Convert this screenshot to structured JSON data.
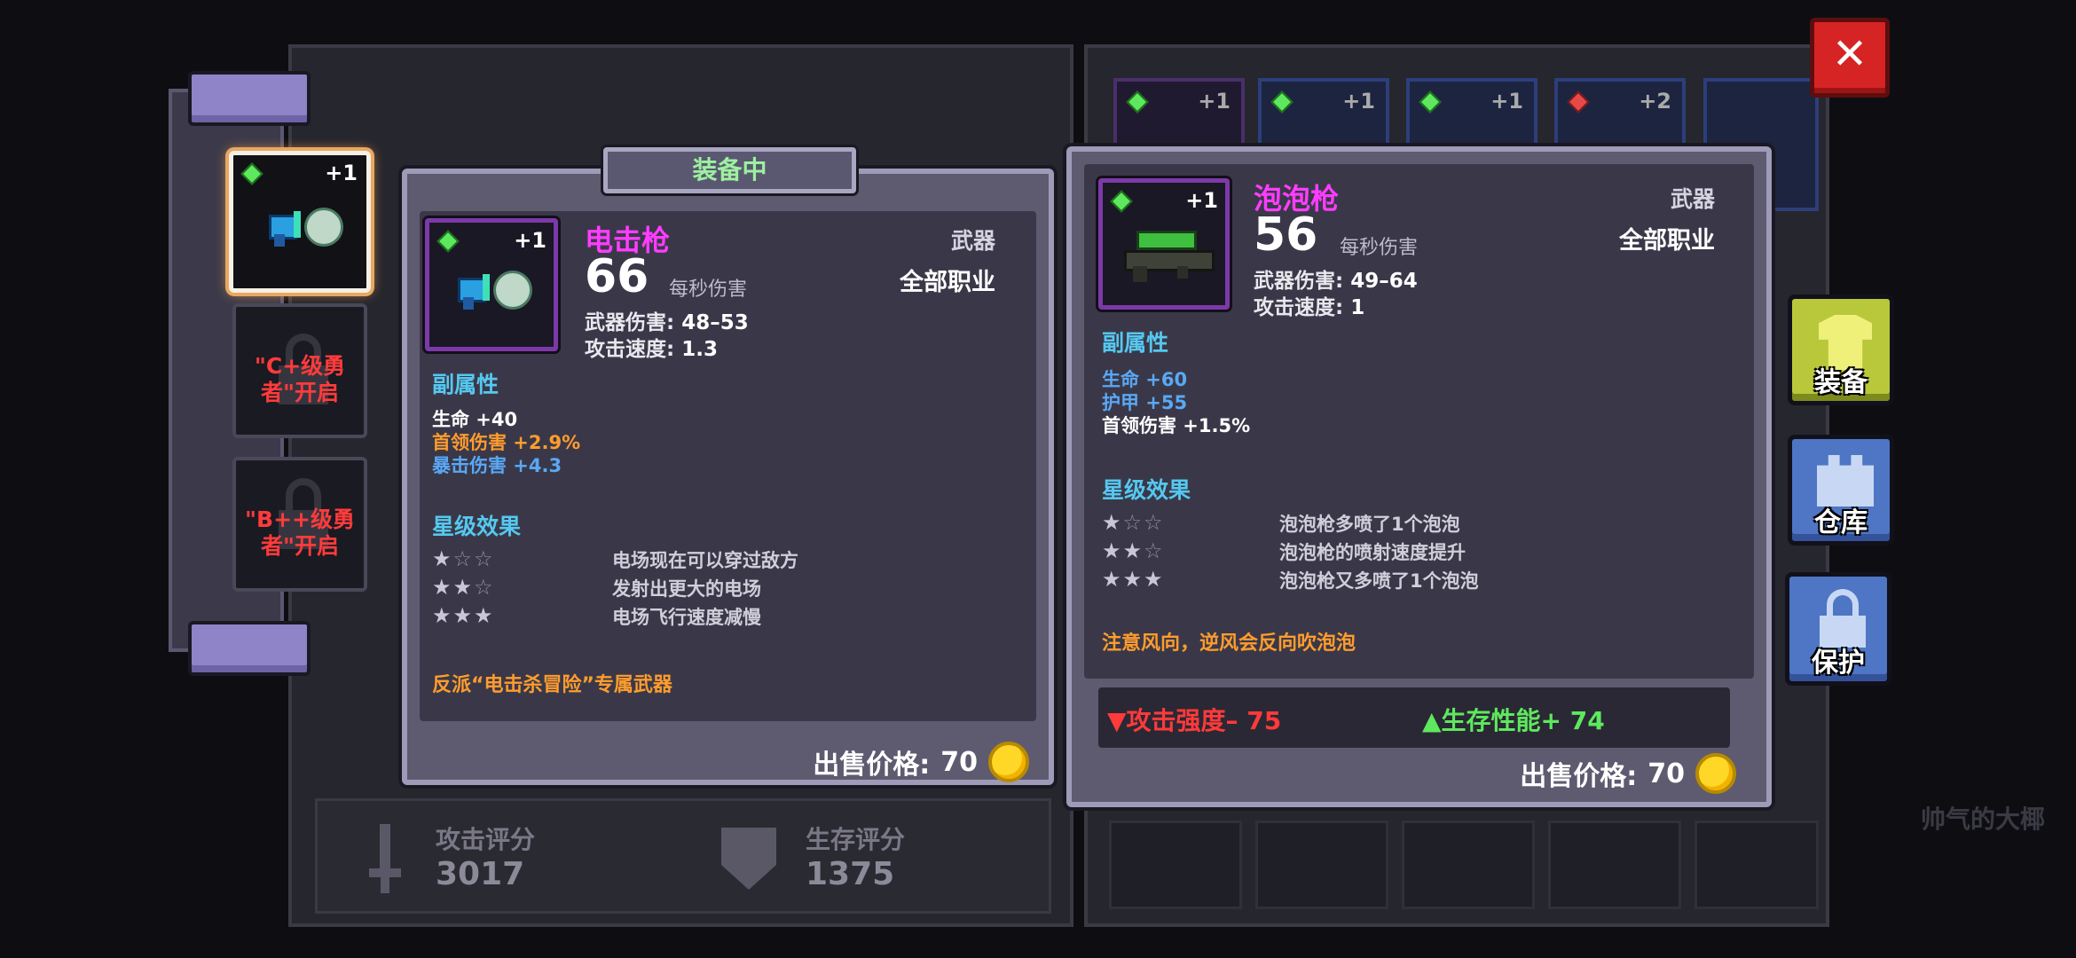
{
  "equipped_tab": "装备中",
  "slots": [
    {
      "level": "+1",
      "active": true
    },
    {
      "locked_text": "\"C+级勇者\"开启"
    },
    {
      "locked_text": "\"B++级勇者\"开启"
    }
  ],
  "equipped": {
    "level": "+1",
    "name": "电击枪",
    "dps": "66",
    "dps_label": "每秒伤害",
    "category": "武器",
    "class": "全部职业",
    "weapon_damage_label": "武器伤害:",
    "weapon_damage": "48–53",
    "attack_speed_label": "攻击速度:",
    "attack_speed": "1.3",
    "sub_title": "副属性",
    "affixes": [
      {
        "text": "生命 +40",
        "color": "#ffffff"
      },
      {
        "text": "首领伤害 +2.9%",
        "color": "#ff9c2e"
      },
      {
        "text": "暴击伤害 +4.3",
        "color": "#5aa8f5"
      }
    ],
    "star_title": "星级效果",
    "star_effects": [
      {
        "stars": 1,
        "text": "电场现在可以穿过敌方"
      },
      {
        "stars": 2,
        "text": "发射出更大的电场"
      },
      {
        "stars": 3,
        "text": "电场飞行速度减慢"
      }
    ],
    "note": "反派“电击杀冒险”专属武器",
    "price_label": "出售价格:",
    "price": "70"
  },
  "candidate": {
    "level": "+1",
    "name": "泡泡枪",
    "dps": "56",
    "dps_label": "每秒伤害",
    "category": "武器",
    "class": "全部职业",
    "weapon_damage_label": "武器伤害:",
    "weapon_damage": "49–64",
    "attack_speed_label": "攻击速度:",
    "attack_speed": "1",
    "sub_title": "副属性",
    "affixes": [
      {
        "text": "生命 +60",
        "color": "#5aa8f5"
      },
      {
        "text": "护甲 +55",
        "color": "#5aa8f5"
      },
      {
        "text": "首领伤害 +1.5%",
        "color": "#ffffff"
      }
    ],
    "star_title": "星级效果",
    "star_effects": [
      {
        "stars": 1,
        "text": "泡泡枪多喷了1个泡泡"
      },
      {
        "stars": 2,
        "text": "泡泡枪的喷射速度提升"
      },
      {
        "stars": 3,
        "text": "泡泡枪又多喷了1个泡泡"
      }
    ],
    "note": "注意风向，逆风会反向吹泡泡",
    "compare_attack": "▼攻击强度– 75",
    "compare_survive": "▲生存性能+ 74",
    "price_label": "出售价格:",
    "price": "70"
  },
  "inventory_levels": [
    "+1",
    "+1",
    "+1",
    "+2"
  ],
  "side_buttons": {
    "equip": "装备",
    "warehouse": "仓库",
    "protect": "保护"
  },
  "scores": {
    "attack_label": "攻击评分",
    "attack_value": "3017",
    "survive_label": "生存评分",
    "survive_value": "1375"
  },
  "bg_text": "帅气的大椰",
  "colors": {
    "name": "#ff3cff",
    "section": "#55c8f0",
    "note": "#ff9c2e",
    "down": "#ff3a3a",
    "up": "#5ee85e"
  }
}
